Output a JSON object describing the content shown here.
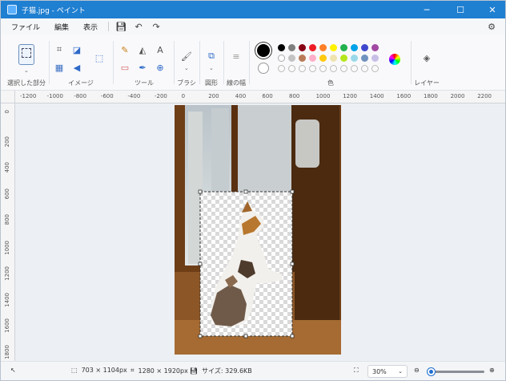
{
  "window": {
    "title": "子猫.jpg - ペイント",
    "minimize_icon": "minimize-icon",
    "maximize_icon": "maximize-icon",
    "close_icon": "close-icon"
  },
  "menu": {
    "file": "ファイル",
    "edit": "編集",
    "view": "表示",
    "save_icon": "save-icon",
    "undo_icon": "undo-icon",
    "redo_icon": "redo-icon",
    "settings_icon": "gear-icon"
  },
  "ribbon": {
    "selection_label": "選択した部分",
    "image_label": "イメージ",
    "tools_label": "ツール",
    "brush_label": "ブラシ",
    "shapes_label": "図形",
    "size_label": "線の幅",
    "colors_label": "色",
    "layers_label": "レイヤー",
    "text_tool_glyph": "A",
    "colors_row1": [
      "#000000",
      "#7f7f7f",
      "#880015",
      "#ed1c24",
      "#ff7f27",
      "#fff200",
      "#22b14c",
      "#00a2e8",
      "#3f48cc",
      "#a349a4"
    ],
    "colors_row2": [
      "#ffffff",
      "#c3c3c3",
      "#b97a57",
      "#ffaec9",
      "#ffc90e",
      "#efe4b0",
      "#b5e61d",
      "#99d9ea",
      "#7092be",
      "#c8bfe7"
    ]
  },
  "ruler": {
    "h_ticks": [
      "-1200",
      "-1000",
      "-800",
      "-600",
      "-400",
      "-200",
      "0",
      "200",
      "400",
      "600",
      "800",
      "1000",
      "1200",
      "1400",
      "1600",
      "1800",
      "2000",
      "2200"
    ],
    "v_ticks": [
      "0",
      "200",
      "400",
      "600",
      "800",
      "1000",
      "1200",
      "1400",
      "1600",
      "1800"
    ]
  },
  "status": {
    "cursor_icon": "pointer-icon",
    "selection_size": "703 × 1104px",
    "canvas_size": "1280 × 1920px",
    "file_size": "サイズ: 329.6KB",
    "zoom": "30%",
    "zoom_level": 0.3
  }
}
